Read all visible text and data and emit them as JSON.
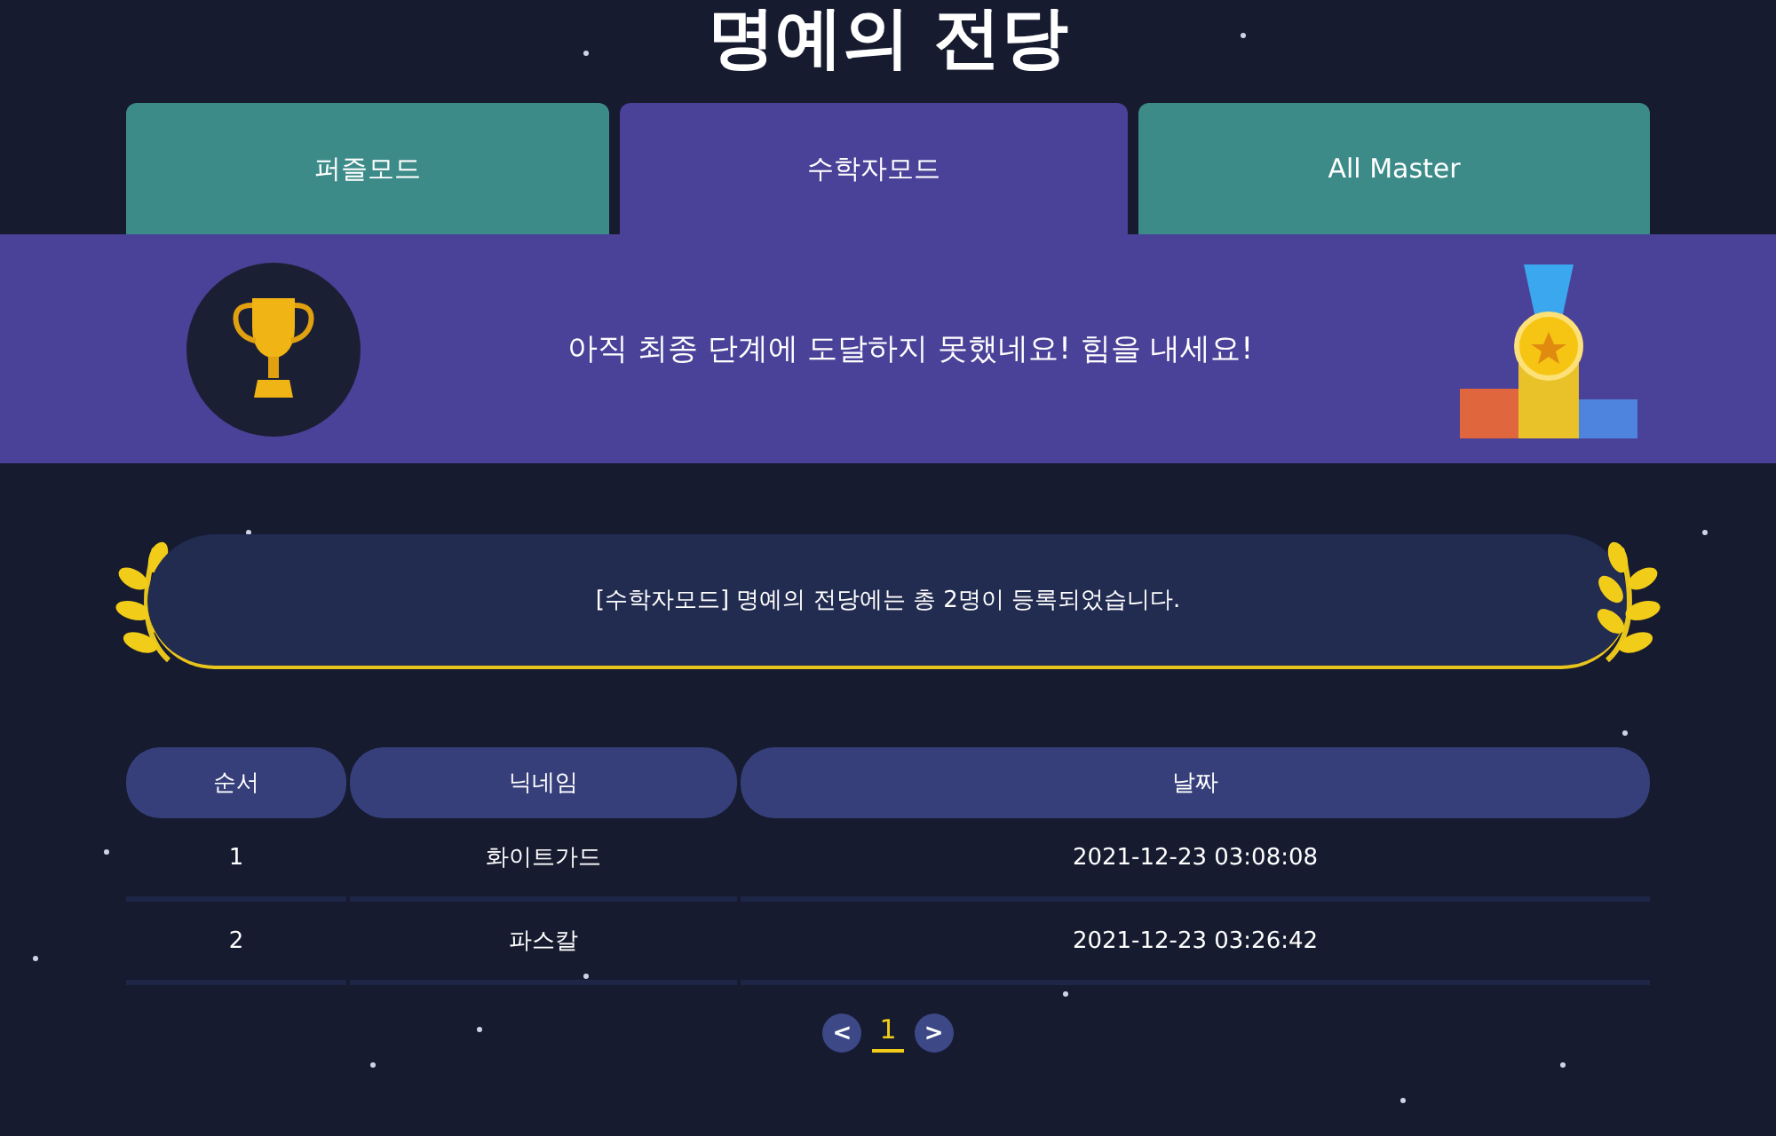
{
  "title": "명예의 전당",
  "tabs": [
    {
      "label": "퍼즐모드",
      "selected": false
    },
    {
      "label": "수학자모드",
      "selected": true
    },
    {
      "label": "All Master",
      "selected": false
    }
  ],
  "banner": {
    "message": "아직 최종 단계에 도달하지 못했네요! 힘을 내세요!"
  },
  "summary": "[수학자모드] 명예의 전당에는 총 2명이 등록되었습니다.",
  "table": {
    "columns": [
      "순서",
      "닉네임",
      "날짜"
    ],
    "rows": [
      [
        "1",
        "화이트가드",
        "2021-12-23 03:08:08"
      ],
      [
        "2",
        "파스칼",
        "2021-12-23 03:26:42"
      ]
    ]
  },
  "pagination": {
    "prev": "<",
    "pages": [
      {
        "label": "1",
        "selected": true
      }
    ],
    "next": ">"
  }
}
